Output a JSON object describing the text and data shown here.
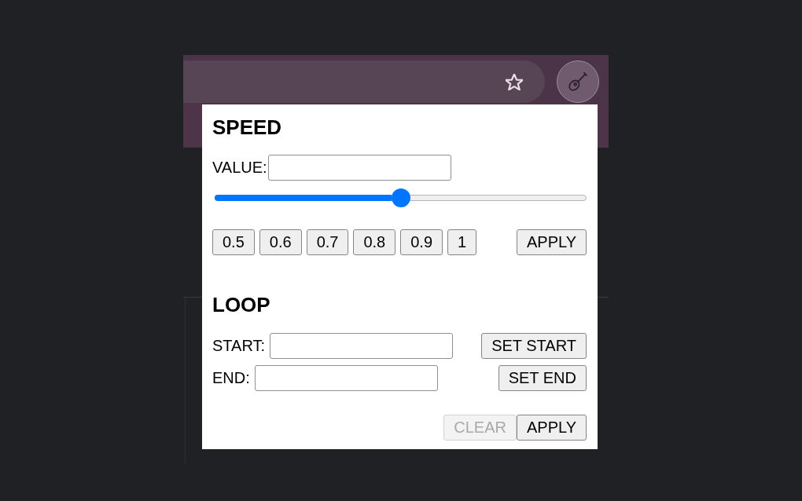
{
  "speed": {
    "title": "SPEED",
    "value_label": "VALUE:",
    "slider": {
      "level": 0.5
    },
    "presets": [
      "0.5",
      "0.6",
      "0.7",
      "0.8",
      "0.9",
      "1"
    ],
    "apply_button": "APPLY"
  },
  "loop": {
    "title": "LOOP",
    "points": [
      {
        "label": "START:",
        "button": "SET START"
      },
      {
        "label": "END:",
        "button": "SET END"
      }
    ],
    "actions": [
      {
        "label": "CLEAR",
        "disabled": true
      },
      {
        "label": "APPLY",
        "disabled": false
      }
    ]
  }
}
